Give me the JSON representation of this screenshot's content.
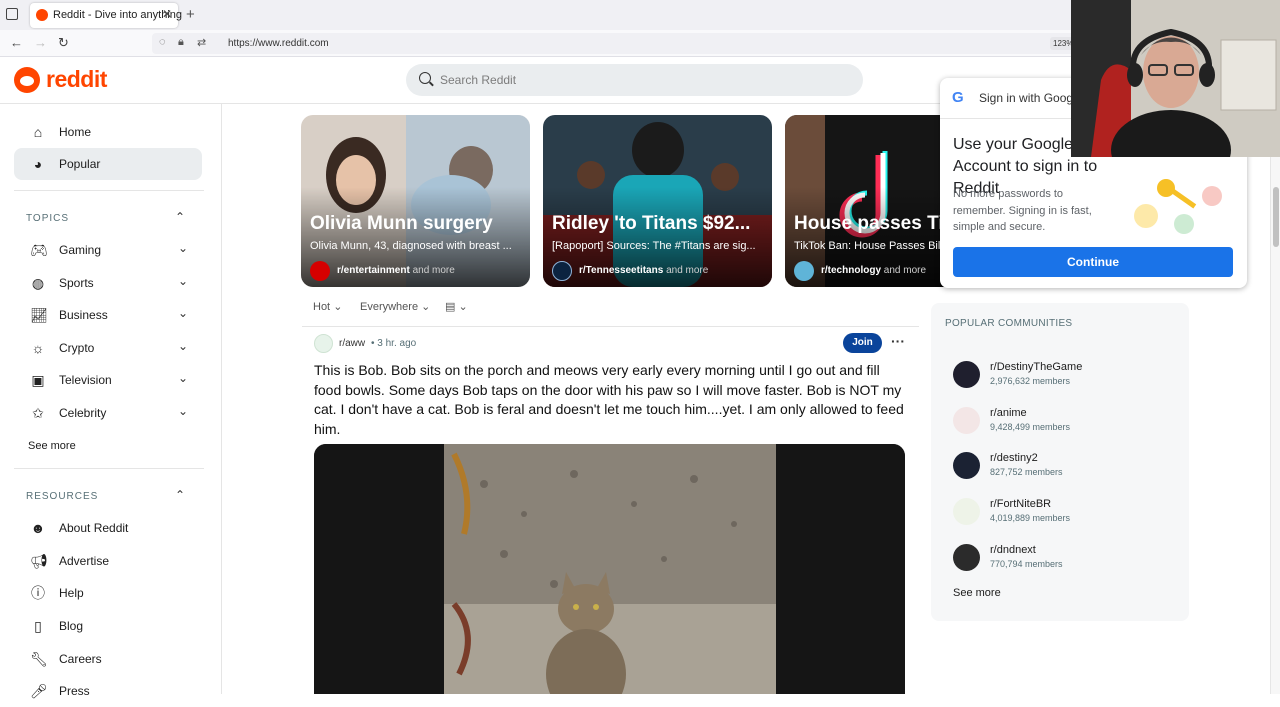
{
  "browser": {
    "tab_title": "Reddit - Dive into anything",
    "url": "https://www.reddit.com",
    "zoom": "123%"
  },
  "header": {
    "logo_text": "reddit",
    "search_placeholder": "Search Reddit"
  },
  "sidebar": {
    "nav": [
      {
        "label": "Home",
        "icon": "home-icon"
      },
      {
        "label": "Popular",
        "icon": "popular-icon",
        "active": true
      }
    ],
    "topics_heading": "TOPICS",
    "topics": [
      {
        "label": "Gaming",
        "icon": "gamepad-icon"
      },
      {
        "label": "Sports",
        "icon": "sports-icon"
      },
      {
        "label": "Business",
        "icon": "chart-icon"
      },
      {
        "label": "Crypto",
        "icon": "crypto-icon"
      },
      {
        "label": "Television",
        "icon": "tv-icon"
      },
      {
        "label": "Celebrity",
        "icon": "star-icon"
      }
    ],
    "see_more": "See more",
    "resources_heading": "RESOURCES",
    "resources": [
      {
        "label": "About Reddit",
        "icon": "reddit-icon"
      },
      {
        "label": "Advertise",
        "icon": "megaphone-icon"
      },
      {
        "label": "Help",
        "icon": "help-icon"
      },
      {
        "label": "Blog",
        "icon": "book-icon"
      },
      {
        "label": "Careers",
        "icon": "wrench-icon"
      },
      {
        "label": "Press",
        "icon": "mic-icon"
      }
    ]
  },
  "carousel": [
    {
      "title": "Olivia Munn surgery",
      "subtitle": "Olivia Munn, 43, diagnosed with breast ...",
      "community": "r/entertainment",
      "and_more": "and more",
      "bg": "#cfc6bd"
    },
    {
      "title": "Ridley 'to Titans $92...",
      "subtitle": "[Rapoport] Sources: The #Titans are sig...",
      "community": "r/Tennesseetitans",
      "and_more": "and more",
      "bg": "#1e5f7a"
    },
    {
      "title": "House passes TikTok",
      "subtitle": "TikTok Ban: House Passes Bill",
      "community": "r/technology",
      "and_more": "and more",
      "bg": "#1a1a1a"
    }
  ],
  "feed_controls": {
    "sort": "Hot",
    "location": "Everywhere"
  },
  "post": {
    "subreddit": "r/aww",
    "time": "• 3 hr. ago",
    "join": "Join",
    "title": "This is Bob. Bob sits on the porch and meows very early every morning until I go out and fill food bowls. Some days Bob taps on the door with his paw so I will move faster. Bob is NOT my cat. I don't have a cat. Bob is feral and doesn't let me touch him....yet. I am only allowed to feed him."
  },
  "communities": {
    "heading": "POPULAR COMMUNITIES",
    "items": [
      {
        "name": "r/DestinyTheGame",
        "members": "2,976,632 members",
        "color": "#1f1f2e"
      },
      {
        "name": "r/anime",
        "members": "9,428,499 members",
        "color": "#f3e6e6"
      },
      {
        "name": "r/destiny2",
        "members": "827,752 members",
        "color": "#1b2233"
      },
      {
        "name": "r/FortNiteBR",
        "members": "4,019,889 members",
        "color": "#eef3e8"
      },
      {
        "name": "r/dndnext",
        "members": "770,794 members",
        "color": "#2b2b2b"
      }
    ],
    "see_more": "See more"
  },
  "google_popup": {
    "header": "Sign in with Google",
    "title": "Use your Google Account to sign in to Reddit",
    "description": "No more passwords to remember. Signing in is fast, simple and secure.",
    "continue": "Continue"
  }
}
